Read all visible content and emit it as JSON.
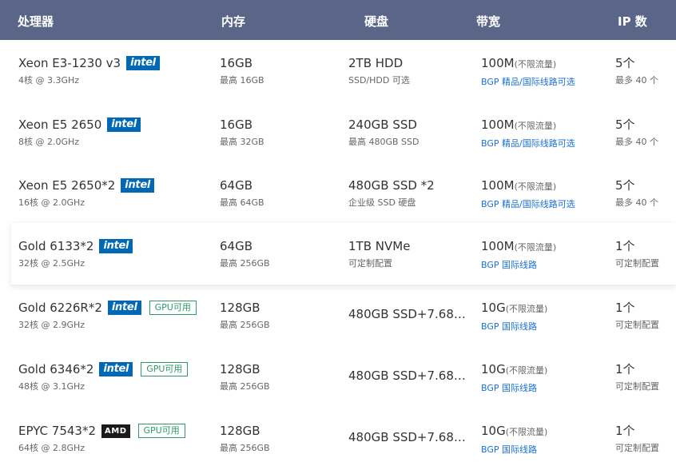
{
  "header": {
    "cpu": "处理器",
    "memory": "内存",
    "disk": "硬盘",
    "bandwidth": "带宽",
    "ip": "IP 数"
  },
  "rows": [
    {
      "cpu": "Xeon E3-1230 v3",
      "brand": "intel",
      "gpu": "",
      "cpu_sub": "4核 @ 3.3GHz",
      "mem": "16GB",
      "mem_sub": "最高 16GB",
      "disk": "2TB HDD",
      "disk_sub": "SSD/HDD 可选",
      "bw": "100M",
      "bw_note": "(不限流量)",
      "bw_sub": "BGP 精品/国际线路可选",
      "ip": "5个",
      "ip_sub": "最多 40 个"
    },
    {
      "cpu": "Xeon E5 2650",
      "brand": "intel",
      "gpu": "",
      "cpu_sub": "8核 @ 2.0GHz",
      "mem": "16GB",
      "mem_sub": "最高 32GB",
      "disk": "240GB SSD",
      "disk_sub": "最高 480GB SSD",
      "bw": "100M",
      "bw_note": "(不限流量)",
      "bw_sub": "BGP 精品/国际线路可选",
      "ip": "5个",
      "ip_sub": "最多 40 个"
    },
    {
      "cpu": "Xeon E5 2650*2",
      "brand": "intel",
      "gpu": "",
      "cpu_sub": "16核 @ 2.0GHz",
      "mem": "64GB",
      "mem_sub": "最高 64GB",
      "disk": "480GB SSD *2",
      "disk_sub": "企业级 SSD 硬盘",
      "bw": "100M",
      "bw_note": "(不限流量)",
      "bw_sub": "BGP 精品/国际线路可选",
      "ip": "5个",
      "ip_sub": "最多 40 个"
    },
    {
      "cpu": "Gold 6133*2",
      "brand": "intel",
      "gpu": "",
      "cpu_sub": "32核 @ 2.5GHz",
      "mem": "64GB",
      "mem_sub": "最高 256GB",
      "disk": "1TB NVMe",
      "disk_sub": "可定制配置",
      "bw": "100M",
      "bw_note": "(不限流量)",
      "bw_sub": "BGP 国际线路",
      "ip": "1个",
      "ip_sub": "可定制配置"
    },
    {
      "cpu": "Gold 6226R*2",
      "brand": "intel",
      "gpu": "GPU可用",
      "cpu_sub": "32核 @ 2.9GHz",
      "mem": "128GB",
      "mem_sub": "最高 256GB",
      "disk": "480GB SSD+7.68…",
      "disk_sub": "",
      "bw": "10G",
      "bw_note": "(不限流量)",
      "bw_sub": "BGP 国际线路",
      "ip": "1个",
      "ip_sub": "可定制配置"
    },
    {
      "cpu": "Gold 6346*2",
      "brand": "intel",
      "gpu": "GPU可用",
      "cpu_sub": "48核 @ 3.1GHz",
      "mem": "128GB",
      "mem_sub": "最高 256GB",
      "disk": "480GB SSD+7.68…",
      "disk_sub": "",
      "bw": "10G",
      "bw_note": "(不限流量)",
      "bw_sub": "BGP 国际线路",
      "ip": "1个",
      "ip_sub": "可定制配置"
    },
    {
      "cpu": "EPYC 7543*2",
      "brand": "AMD",
      "gpu": "GPU可用",
      "cpu_sub": "64核 @ 2.8GHz",
      "mem": "128GB",
      "mem_sub": "最高 256GB",
      "disk": "480GB SSD+7.68…",
      "disk_sub": "",
      "bw": "10G",
      "bw_note": "(不限流量)",
      "bw_sub": "BGP 国际线路",
      "ip": "1个",
      "ip_sub": "可定制配置"
    }
  ],
  "brands": {
    "intel": "intel",
    "amd": "AMD"
  },
  "colors": {
    "header_bg": "#5a6587",
    "intel": "#0068b5",
    "gpu": "#2e9a6a",
    "link": "#1a6fd8"
  }
}
